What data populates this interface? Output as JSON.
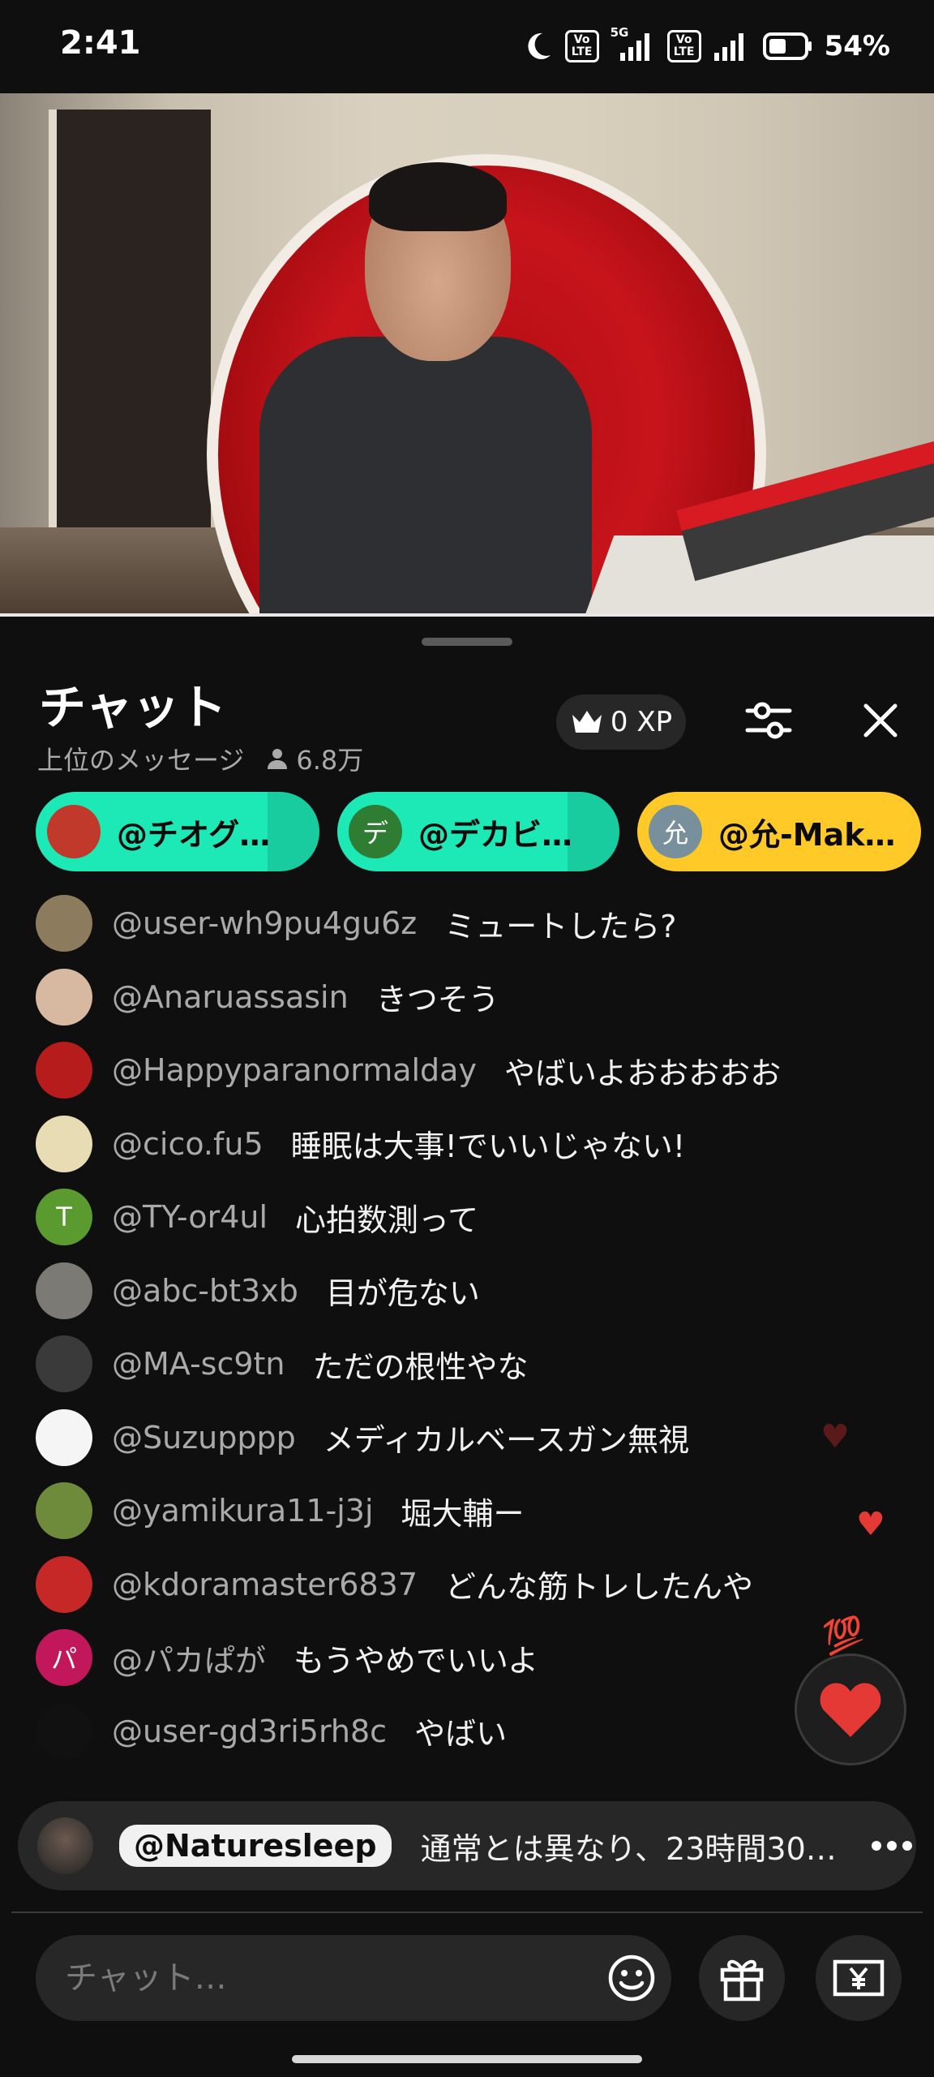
{
  "status_bar": {
    "time": "2:41",
    "network": "5G",
    "volte": "Vo LTE",
    "battery": "54%"
  },
  "chat": {
    "title": "チャット",
    "filter_label": "上位のメッセージ",
    "viewer_count": "6.8万",
    "xp": "0 XP",
    "pinned_users": [
      {
        "name": "@チオグ…",
        "color": "#1de9b6",
        "avatar_color": "#c0392b",
        "avatar_text": ""
      },
      {
        "name": "@デカビ…",
        "color": "#1de9b6",
        "avatar_color": "#2e7d32",
        "avatar_text": "デ"
      },
      {
        "name": "@允-Mak…",
        "color": "#ffca28",
        "avatar_color": "#78909c",
        "avatar_text": "允"
      }
    ],
    "messages": [
      {
        "author": "@user-wh9pu4gu6z",
        "text": "ミュートしたら?",
        "avatar_color": "#8d7b5e",
        "avatar_text": ""
      },
      {
        "author": "@Anaruassasin",
        "text": "きつそう",
        "avatar_color": "#d7b9a2",
        "avatar_text": ""
      },
      {
        "author": "@Happyparanormalday",
        "text": "やばいよおおおおお",
        "avatar_color": "#b71c1c",
        "avatar_text": ""
      },
      {
        "author": "@cico.fu5",
        "text": "睡眠は大事!でいいじゃない!",
        "avatar_color": "#e8dcb5",
        "avatar_text": ""
      },
      {
        "author": "@TY-or4ul",
        "text": "心拍数測って",
        "avatar_color": "#5b9a2f",
        "avatar_text": "T"
      },
      {
        "author": "@abc-bt3xb",
        "text": "目が危ない",
        "avatar_color": "#7c7a74",
        "avatar_text": ""
      },
      {
        "author": "@MA-sc9tn",
        "text": "ただの根性やな",
        "avatar_color": "#3b3a3a",
        "avatar_text": ""
      },
      {
        "author": "@Suzupppp",
        "text": "メディカルベースガン無視",
        "avatar_color": "#f5f5f5",
        "avatar_text": ""
      },
      {
        "author": "@yamikura11-j3j",
        "text": "堀大輔ー",
        "avatar_color": "#6d8b3a",
        "avatar_text": ""
      },
      {
        "author": "@kdoramaster6837",
        "text": "どんな筋トレしたんや",
        "avatar_color": "#c62828",
        "avatar_text": ""
      },
      {
        "author": "@パカぱが",
        "text": "もうやめでいいよ",
        "avatar_color": "#c2185b",
        "avatar_text": "パ"
      },
      {
        "author": "@user-gd3ri5rh8c",
        "text": "やばい",
        "avatar_color": "#111111",
        "avatar_text": ""
      }
    ],
    "pinned_message": {
      "author": "@Naturesleep",
      "text": "通常とは異なり、23時間30…"
    },
    "input_placeholder": "チャット…",
    "reaction_badge": "💯"
  },
  "colors": {
    "background": "#0f0f0f",
    "surface": "#272727",
    "accent_heart": "#e53935"
  },
  "icons": {
    "dnd": "moon-icon",
    "signal": "signal-icon",
    "battery": "battery-icon",
    "crown": "crown-icon",
    "settings": "sliders-icon",
    "close": "close-icon",
    "viewers": "person-icon",
    "emoji": "emoji-icon",
    "gift": "gift-icon",
    "super_chat": "yen-icon",
    "more": "more-icon",
    "heart": "heart-icon"
  }
}
